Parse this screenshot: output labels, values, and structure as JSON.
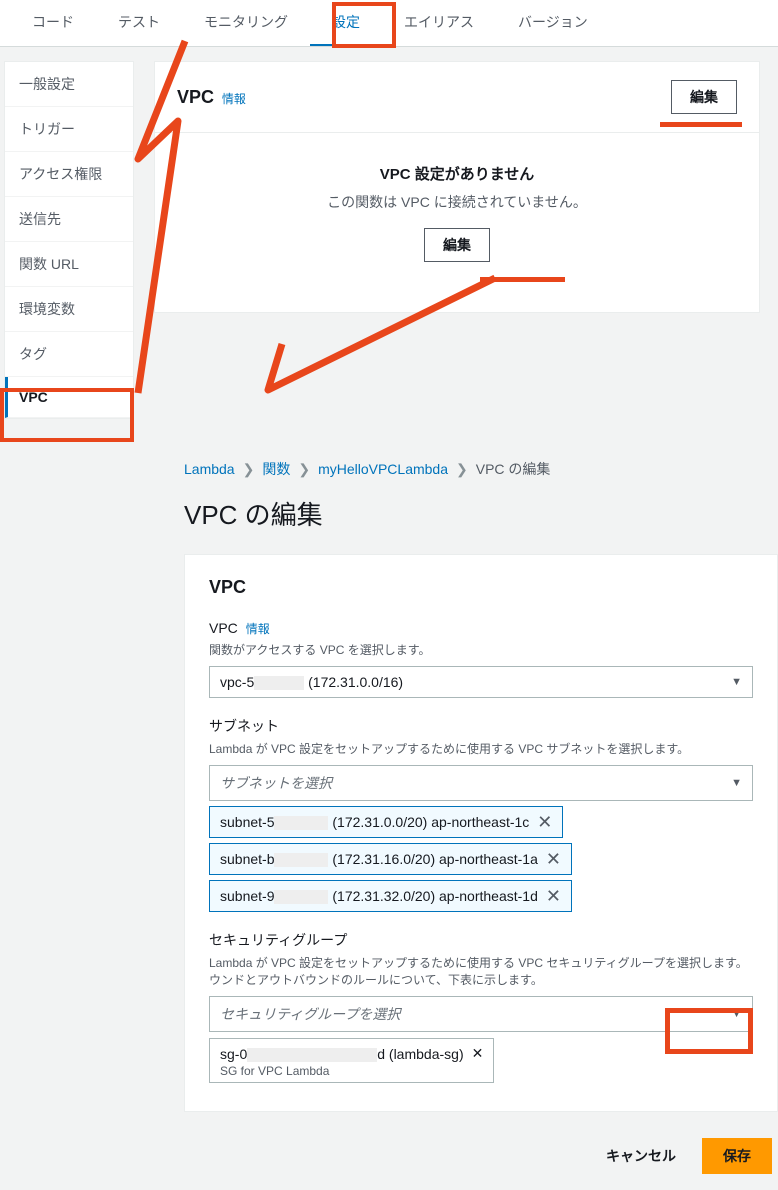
{
  "tabs": {
    "code": "コード",
    "test": "テスト",
    "monitoring": "モニタリング",
    "settings": "設定",
    "alias": "エイリアス",
    "version": "バージョン"
  },
  "sidebar": {
    "items": [
      {
        "label": "一般設定"
      },
      {
        "label": "トリガー"
      },
      {
        "label": "アクセス権限"
      },
      {
        "label": "送信先"
      },
      {
        "label": "関数 URL"
      },
      {
        "label": "環境変数"
      },
      {
        "label": "タグ"
      },
      {
        "label": "VPC"
      }
    ]
  },
  "vpc_panel": {
    "title": "VPC",
    "info": "情報",
    "edit": "編集",
    "empty_title": "VPC 設定がありません",
    "empty_desc": "この関数は VPC に接続されていません。"
  },
  "breadcrumb": {
    "lambda": "Lambda",
    "functions": "関数",
    "fn_name": "myHelloVPCLambda",
    "current": "VPC の編集"
  },
  "page_title": "VPC の編集",
  "form": {
    "panel_title": "VPC",
    "vpc_label": "VPC",
    "vpc_info": "情報",
    "vpc_desc": "関数がアクセスする VPC を選択します。",
    "vpc_value_prefix": "vpc-5",
    "vpc_value_suffix": " (172.31.0.0/16)",
    "subnet_label": "サブネット",
    "subnet_desc": "Lambda が VPC 設定をセットアップするために使用する VPC サブネットを選択します。",
    "subnet_placeholder": "サブネットを選択",
    "subnets": [
      {
        "prefix": "subnet-5",
        "suffix": " (172.31.0.0/20)   ap-northeast-1c"
      },
      {
        "prefix": "subnet-b",
        "suffix": " (172.31.16.0/20)   ap-northeast-1a"
      },
      {
        "prefix": "subnet-9",
        "suffix": " (172.31.32.0/20)   ap-northeast-1d"
      }
    ],
    "sg_label": "セキュリティグループ",
    "sg_desc": "Lambda が VPC 設定をセットアップするために使用する VPC セキュリティグループを選択します。ウンドとアウトバウンドのルールについて、下表に示します。",
    "sg_placeholder": "セキュリティグループを選択",
    "sg_chip_prefix": "sg-0",
    "sg_chip_suffix": "d (lambda-sg)",
    "sg_chip_desc": "SG for VPC Lambda"
  },
  "footer": {
    "cancel": "キャンセル",
    "save": "保存"
  }
}
